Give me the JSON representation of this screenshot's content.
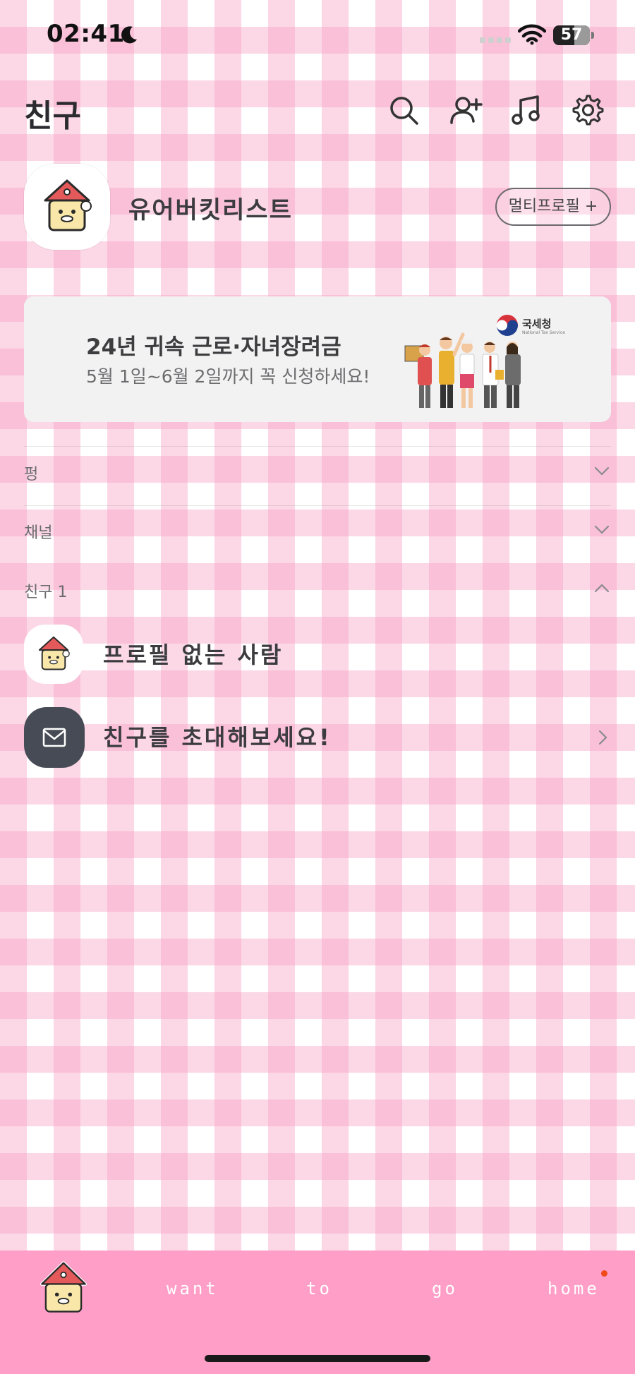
{
  "status_bar": {
    "time": "02:41",
    "battery": "57",
    "battery_level": 0.57
  },
  "header": {
    "title": "친구",
    "icons": [
      "search-icon",
      "add-friend-icon",
      "music-icon",
      "settings-icon"
    ]
  },
  "profile": {
    "name": "유어버킷리스트",
    "multi_profile_label": "멀티프로필 +"
  },
  "banner": {
    "title": "24년 귀속 근로·자녀장려금",
    "subtitle": "5월 1일~6월 2일까지 꼭 신청하세요!",
    "brand": "국세청",
    "brand_sub": "National Tax Service"
  },
  "sections": [
    {
      "label": "펑",
      "state": "collapsed"
    },
    {
      "label": "채널",
      "state": "collapsed"
    },
    {
      "label": "친구 1",
      "state": "expanded"
    }
  ],
  "friends": [
    {
      "name": "프로필 없는 사람"
    }
  ],
  "invite": {
    "label": "친구를 초대해보세요!"
  },
  "tab_bar": {
    "words": [
      "want",
      "to",
      "go",
      "home"
    ],
    "colors": {
      "bar": "#ff9fc8",
      "badge": "#f04a1a"
    }
  },
  "colors": {
    "checker_pink": "#f7a0c4",
    "banner_bg": "#f2f2f2",
    "invite_icon_bg": "#474b55"
  }
}
